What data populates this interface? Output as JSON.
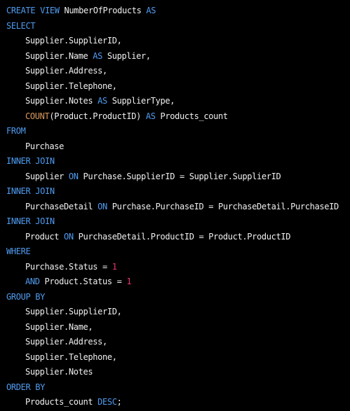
{
  "colors": {
    "background": "#000000",
    "keyword": "#4f9cf0",
    "function": "#d99a5c",
    "number": "#e8356d",
    "text": "#f0f0f0"
  },
  "lines": [
    {
      "indent": 0,
      "tokens": [
        {
          "t": "kw",
          "v": "CREATE VIEW"
        },
        {
          "t": "tx",
          "v": " NumberOfProducts "
        },
        {
          "t": "kw",
          "v": "AS"
        }
      ]
    },
    {
      "indent": 0,
      "tokens": [
        {
          "t": "kw",
          "v": "SELECT"
        }
      ]
    },
    {
      "indent": 1,
      "tokens": [
        {
          "t": "tx",
          "v": "Supplier.SupplierID,"
        }
      ]
    },
    {
      "indent": 1,
      "tokens": [
        {
          "t": "tx",
          "v": "Supplier.Name "
        },
        {
          "t": "kw",
          "v": "AS"
        },
        {
          "t": "tx",
          "v": " Supplier,"
        }
      ]
    },
    {
      "indent": 1,
      "tokens": [
        {
          "t": "tx",
          "v": "Supplier.Address,"
        }
      ]
    },
    {
      "indent": 1,
      "tokens": [
        {
          "t": "tx",
          "v": "Supplier.Telephone,"
        }
      ]
    },
    {
      "indent": 1,
      "tokens": [
        {
          "t": "tx",
          "v": "Supplier.Notes "
        },
        {
          "t": "kw",
          "v": "AS"
        },
        {
          "t": "tx",
          "v": " SupplierType,"
        }
      ]
    },
    {
      "indent": 1,
      "tokens": [
        {
          "t": "fn",
          "v": "COUNT"
        },
        {
          "t": "tx",
          "v": "(Product.ProductID) "
        },
        {
          "t": "kw",
          "v": "AS"
        },
        {
          "t": "tx",
          "v": " Products_count"
        }
      ]
    },
    {
      "indent": 0,
      "tokens": [
        {
          "t": "kw",
          "v": "FROM"
        }
      ]
    },
    {
      "indent": 1,
      "tokens": [
        {
          "t": "tx",
          "v": "Purchase"
        }
      ]
    },
    {
      "indent": 0,
      "tokens": [
        {
          "t": "kw",
          "v": "INNER JOIN"
        }
      ]
    },
    {
      "indent": 1,
      "tokens": [
        {
          "t": "tx",
          "v": "Supplier "
        },
        {
          "t": "kw",
          "v": "ON"
        },
        {
          "t": "tx",
          "v": " Purchase.SupplierID = Supplier.SupplierID"
        }
      ]
    },
    {
      "indent": 0,
      "tokens": [
        {
          "t": "kw",
          "v": "INNER JOIN"
        }
      ]
    },
    {
      "indent": 1,
      "tokens": [
        {
          "t": "tx",
          "v": "PurchaseDetail "
        },
        {
          "t": "kw",
          "v": "ON"
        },
        {
          "t": "tx",
          "v": " Purchase.PurchaseID = PurchaseDetail.PurchaseID"
        }
      ]
    },
    {
      "indent": 0,
      "tokens": [
        {
          "t": "kw",
          "v": "INNER JOIN"
        }
      ]
    },
    {
      "indent": 1,
      "tokens": [
        {
          "t": "tx",
          "v": "Product "
        },
        {
          "t": "kw",
          "v": "ON"
        },
        {
          "t": "tx",
          "v": " PurchaseDetail.ProductID = Product.ProductID"
        }
      ]
    },
    {
      "indent": 0,
      "tokens": [
        {
          "t": "kw",
          "v": "WHERE"
        }
      ]
    },
    {
      "indent": 1,
      "tokens": [
        {
          "t": "tx",
          "v": "Purchase.Status = "
        },
        {
          "t": "num",
          "v": "1"
        }
      ]
    },
    {
      "indent": 1,
      "tokens": [
        {
          "t": "kw",
          "v": "AND"
        },
        {
          "t": "tx",
          "v": " Product.Status = "
        },
        {
          "t": "num",
          "v": "1"
        }
      ]
    },
    {
      "indent": 0,
      "tokens": [
        {
          "t": "kw",
          "v": "GROUP BY"
        }
      ]
    },
    {
      "indent": 1,
      "tokens": [
        {
          "t": "tx",
          "v": "Supplier.SupplierID,"
        }
      ]
    },
    {
      "indent": 1,
      "tokens": [
        {
          "t": "tx",
          "v": "Supplier.Name,"
        }
      ]
    },
    {
      "indent": 1,
      "tokens": [
        {
          "t": "tx",
          "v": "Supplier.Address,"
        }
      ]
    },
    {
      "indent": 1,
      "tokens": [
        {
          "t": "tx",
          "v": "Supplier.Telephone,"
        }
      ]
    },
    {
      "indent": 1,
      "tokens": [
        {
          "t": "tx",
          "v": "Supplier.Notes"
        }
      ]
    },
    {
      "indent": 0,
      "tokens": [
        {
          "t": "kw",
          "v": "ORDER BY"
        }
      ]
    },
    {
      "indent": 1,
      "tokens": [
        {
          "t": "tx",
          "v": "Products_count "
        },
        {
          "t": "kw",
          "v": "DESC"
        },
        {
          "t": "tx",
          "v": ";"
        }
      ]
    }
  ]
}
